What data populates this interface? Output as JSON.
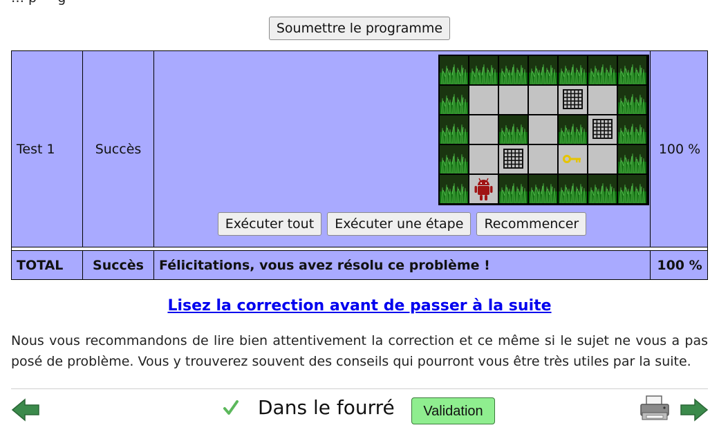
{
  "submit_button": "Soumettre le programme",
  "results_table": {
    "test_row": {
      "name": "Test 1",
      "status": "Succès",
      "score": "100 %"
    },
    "controls": {
      "run_all": "Exécuter tout",
      "run_step": "Exécuter une étape",
      "reset": "Recommencer"
    },
    "total_row": {
      "label": "TOTAL",
      "status": "Succès",
      "message": "Félicitations, vous avez résolu ce problème !",
      "score": "100 %"
    }
  },
  "board": {
    "rows": [
      [
        "grass",
        "grass",
        "grass",
        "grass",
        "grass",
        "grass",
        "grass"
      ],
      [
        "grass",
        "empty",
        "empty",
        "empty",
        "cage",
        "empty",
        "grass"
      ],
      [
        "grass",
        "empty",
        "grass",
        "empty",
        "grass",
        "cage",
        "grass"
      ],
      [
        "grass",
        "empty",
        "cage",
        "empty",
        "key",
        "empty",
        "grass"
      ],
      [
        "grass",
        "robot",
        "grass",
        "grass",
        "grass",
        "grass",
        "grass"
      ]
    ]
  },
  "correction_link": "Lisez la correction avant de passer à la suite",
  "advice_text": "Nous vous recommandons de lire bien attentivement la correction et ce même si le sujet ne vous a pas posé de problème. Vous y trouverez souvent des conseils qui pourront vous être très utiles par la suite.",
  "footer": {
    "task_title": "Dans le fourré",
    "validation_label": "Validation",
    "icons": [
      "arrow-left-icon",
      "check-icon",
      "printer-icon",
      "arrow-right-icon"
    ]
  },
  "colors": {
    "table_bg": "#a9aaff",
    "link": "#0000ee",
    "validation_bg": "#8fee8f",
    "arrow": "#3b8a4b"
  }
}
